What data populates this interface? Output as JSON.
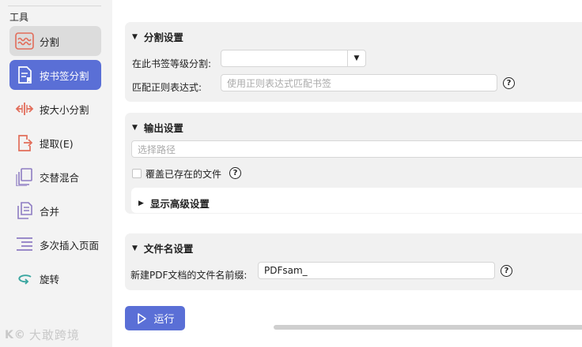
{
  "sidebar": {
    "title": "工具",
    "items": [
      {
        "label": "分割",
        "icon": "split-wave-icon",
        "state": "hover"
      },
      {
        "label": "按书签分割",
        "icon": "bookmark-doc-icon",
        "state": "active"
      },
      {
        "label": "按大小分割",
        "icon": "size-split-icon",
        "state": "normal"
      },
      {
        "label": "提取(E)",
        "icon": "extract-icon",
        "state": "normal"
      },
      {
        "label": "交替混合",
        "icon": "alternate-mix-icon",
        "state": "normal"
      },
      {
        "label": "合并",
        "icon": "merge-icon",
        "state": "normal"
      },
      {
        "label": "多次插入页面",
        "icon": "multi-insert-icon",
        "state": "normal"
      },
      {
        "label": "旋转",
        "icon": "rotate-icon",
        "state": "normal"
      }
    ]
  },
  "watermark": {
    "text": "大敢跨境"
  },
  "split_settings": {
    "title": "分割设置",
    "level_label": "在此书签等级分割:",
    "level_value": "",
    "regex_label": "匹配正则表达式:",
    "regex_placeholder": "使用正则表达式匹配书签"
  },
  "output_settings": {
    "title": "输出设置",
    "path_placeholder": "选择路径",
    "overwrite_label": "覆盖已存在的文件",
    "advanced_label": "显示高级设置"
  },
  "filename_settings": {
    "title": "文件名设置",
    "prefix_label": "新建PDF文档的文件名前缀:",
    "prefix_value": "PDFsam_"
  },
  "run_button": {
    "label": "运行"
  },
  "help_symbol": "?",
  "colors": {
    "accent": "#5a6fd6",
    "icon_red": "#e26d5a",
    "icon_purple": "#8e7cc3",
    "icon_teal": "#3aa6a0"
  }
}
